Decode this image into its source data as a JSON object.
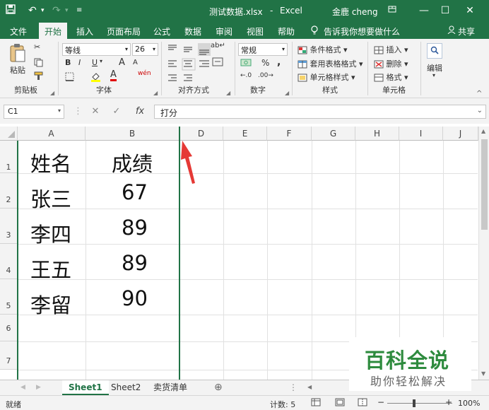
{
  "title": {
    "file": "测试数据.xlsx",
    "sep": "-",
    "app": "Excel",
    "user": "金鹿 cheng"
  },
  "tabs": [
    "文件",
    "开始",
    "插入",
    "页面布局",
    "公式",
    "数据",
    "审阅",
    "视图",
    "帮助"
  ],
  "tell_me": "告诉我你想要做什么",
  "share": "共享",
  "ribbon": {
    "paste": "粘贴",
    "clipboard": "剪贴板",
    "font_name": "等线",
    "font_size": "26",
    "font_group": "字体",
    "bold": "B",
    "italic": "I",
    "underline": "U",
    "grow": "A",
    "shrink": "A",
    "wen": "wén",
    "align_group": "对齐方式",
    "num_format": "常规",
    "number_group": "数字",
    "percent": "%",
    "comma": ",",
    "cond_format": "条件格式",
    "table_format": "套用表格格式",
    "cell_style": "单元格样式",
    "styles_group": "样式",
    "insert": "插入",
    "delete": "删除",
    "format": "格式",
    "cells_group": "单元格",
    "edit": "编辑"
  },
  "name_box": "C1",
  "fx": "fx",
  "formula": "打分",
  "columns": [
    "A",
    "B",
    "D",
    "E",
    "F",
    "G",
    "H",
    "I",
    "J"
  ],
  "rows": [
    "1",
    "2",
    "3",
    "4",
    "5",
    "6",
    "7"
  ],
  "cells": [
    [
      "姓名",
      "成绩"
    ],
    [
      "张三",
      "67"
    ],
    [
      "李四",
      "89"
    ],
    [
      "王五",
      "89"
    ],
    [
      "李留",
      "90"
    ]
  ],
  "sheets": [
    "Sheet1",
    "Sheet2",
    "卖货清单"
  ],
  "status": {
    "ready": "就绪",
    "count": "计数: 5",
    "zoom": "100%"
  },
  "watermark": {
    "main": "百科全说",
    "sub": "助你轻松解决"
  },
  "colors": {
    "excel_green": "#217346",
    "watermark_green": "#2e8b3e",
    "arrow_red": "#e53935"
  }
}
